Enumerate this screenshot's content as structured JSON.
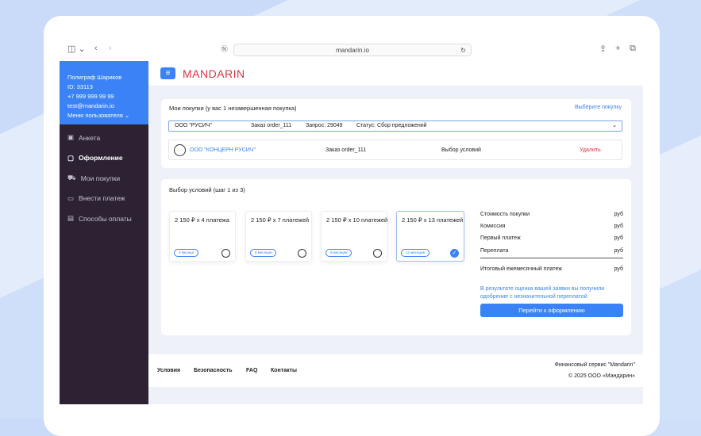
{
  "browser": {
    "url": "mandarin.io"
  },
  "user": {
    "name": "Полиграф Шариков",
    "id": "ID: 33113",
    "phone": "+7 999 999 99 99",
    "email": "test@mandarin.io",
    "menu": "Меню пользователя"
  },
  "nav": [
    {
      "label": "Анкета"
    },
    {
      "label": "Оформление"
    },
    {
      "label": "Мои покупки"
    },
    {
      "label": "Внести платеж"
    },
    {
      "label": "Способы оплаты"
    }
  ],
  "header": {
    "logo": "MANDARIN"
  },
  "purchases": {
    "title": "Мои покупки (у вас 1 незавершенная покупка)",
    "select_link": "Выберите покупку",
    "selected": {
      "company": "ООО \"РУСИЧ\"",
      "order": "Заказ order_111",
      "request": "Запрос: 29049",
      "status": "Статус: Сбор предложений"
    },
    "item": {
      "company": "ООО \"КОНЦЕРН РУСИЧ\"",
      "order": "Заказ order_111",
      "stage": "Выбор условий",
      "delete": "Удалить"
    }
  },
  "conditions": {
    "title": "Выбор условий (шаг 1 из 3)",
    "options": [
      {
        "label": "2 150 ₽ x 4 платежа",
        "term": "3 месяца",
        "selected": false
      },
      {
        "label": "2 150 ₽ x 7 платежей",
        "term": "6 месяцев",
        "selected": false
      },
      {
        "label": "2 150 ₽ x 10 платежей",
        "term": "9 месяцев",
        "selected": false
      },
      {
        "label": "2 150 ₽ x 13 платежей",
        "term": "12 месяцев",
        "selected": true
      }
    ],
    "summary": [
      {
        "label": "Стоимость покупки",
        "value": "руб"
      },
      {
        "label": "Комиссия",
        "value": "руб"
      },
      {
        "label": "Первый платеж",
        "value": "руб"
      },
      {
        "label": "Переплата",
        "value": "руб"
      }
    ],
    "total": {
      "label": "Итоговый ежемесячный платеж",
      "value": "руб"
    },
    "note": "В результате оценка вашей заявки вы получили одобрение с незначительной переплатой",
    "button": "Перейти к оформлению"
  },
  "footer": {
    "links": [
      "Условия",
      "Безопасность",
      "FAQ",
      "Контакты"
    ],
    "service": "Финансовый сервис \"Mandarin\"",
    "copyright": "© 2025 ООО «Мандарин»"
  }
}
